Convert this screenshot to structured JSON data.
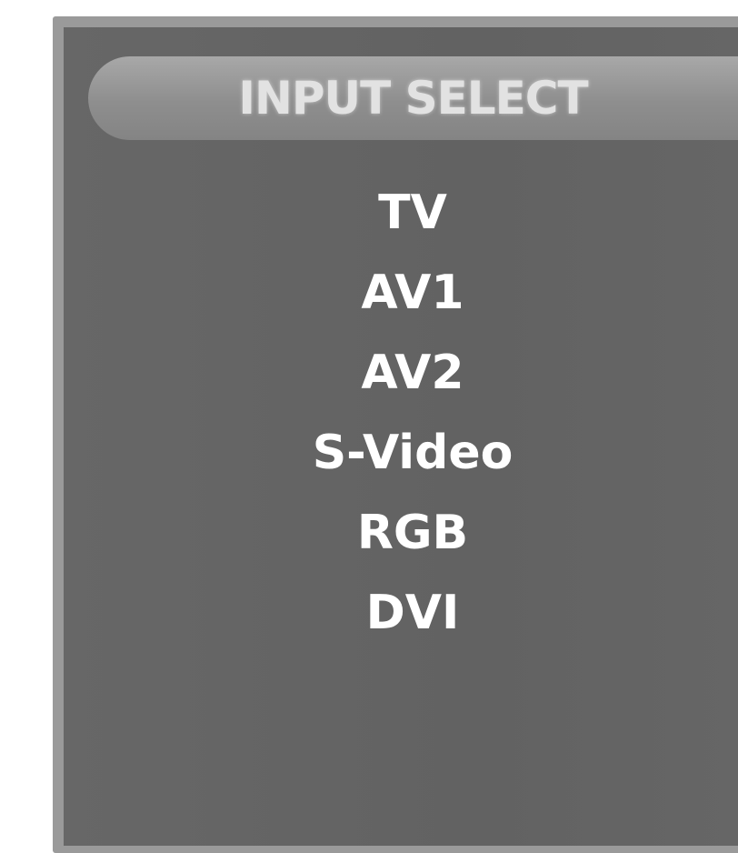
{
  "menu": {
    "title": "INPUT SELECT",
    "items": [
      {
        "label": "TV"
      },
      {
        "label": "AV1"
      },
      {
        "label": "AV2"
      },
      {
        "label": "S-Video"
      },
      {
        "label": "RGB"
      },
      {
        "label": "DVI"
      }
    ]
  },
  "colors": {
    "panel": "#666666",
    "frame": "#9a9a9a",
    "title_bar": "#9a9a9a",
    "title_text": "#e2e2e2",
    "item_text": "#ffffff"
  }
}
